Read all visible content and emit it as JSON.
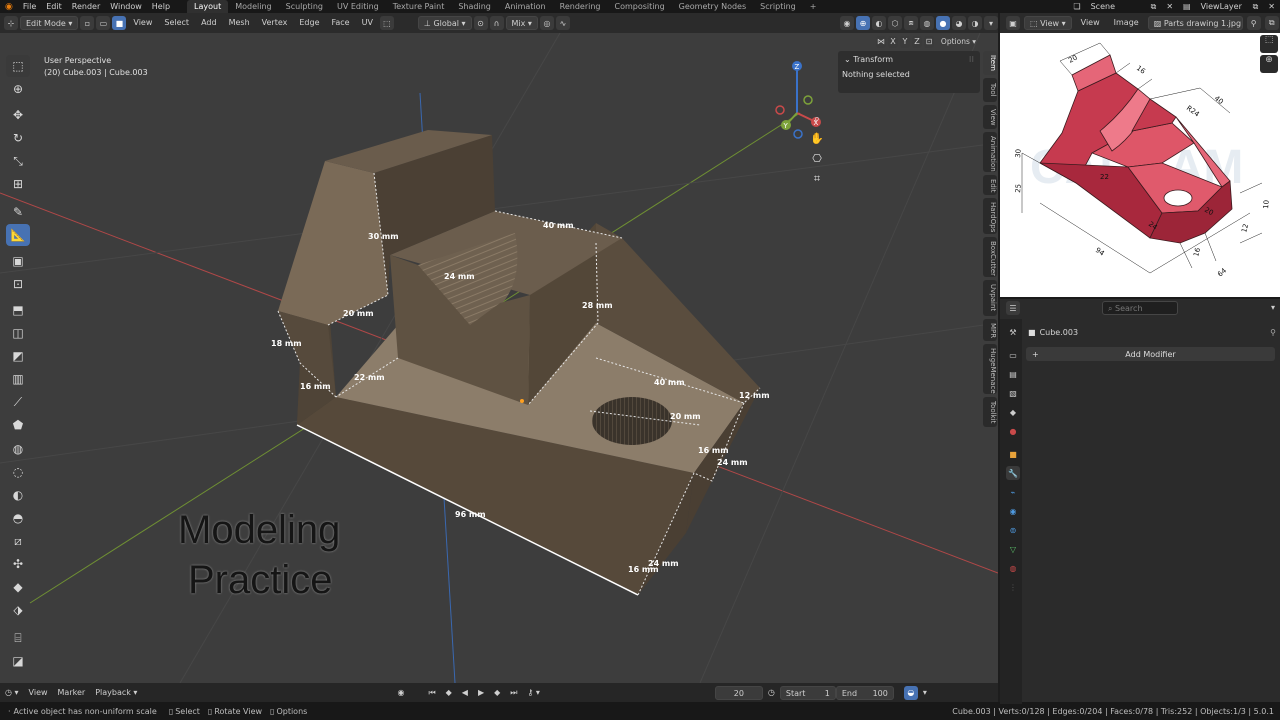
{
  "topbar": {
    "menus": [
      "File",
      "Edit",
      "Render",
      "Window",
      "Help"
    ],
    "workspaces": [
      "Layout",
      "Modeling",
      "Sculpting",
      "UV Editing",
      "Texture Paint",
      "Shading",
      "Animation",
      "Rendering",
      "Compositing",
      "Geometry Nodes",
      "Scripting"
    ],
    "add_tab": "+",
    "scene": "Scene",
    "view_layer": "ViewLayer"
  },
  "viewport_header": {
    "mode": "Edit Mode",
    "menus": [
      "View",
      "Select",
      "Add",
      "Mesh",
      "Vertex",
      "Edge",
      "Face",
      "UV"
    ],
    "orientation": "Global",
    "snap_mode": "Mix",
    "options": "Options",
    "xyz": [
      "X",
      "Y",
      "Z"
    ]
  },
  "viewport": {
    "perspective": "User Perspective",
    "object_info": "(20) Cube.003 | Cube.003",
    "overlay_title_1": "Modeling",
    "overlay_title_2": "Practice",
    "dims": [
      {
        "id": "d30",
        "text": "30 mm"
      },
      {
        "id": "d40a",
        "text": "40 mm"
      },
      {
        "id": "d24a",
        "text": "24 mm"
      },
      {
        "id": "d28",
        "text": "28 mm"
      },
      {
        "id": "d20a",
        "text": "20 mm"
      },
      {
        "id": "d18",
        "text": "18 mm"
      },
      {
        "id": "d16a",
        "text": "16 mm"
      },
      {
        "id": "d22",
        "text": "22 mm"
      },
      {
        "id": "d40b",
        "text": "40 mm"
      },
      {
        "id": "d12",
        "text": "12 mm"
      },
      {
        "id": "d20b",
        "text": "20 mm"
      },
      {
        "id": "d16b",
        "text": "16 mm"
      },
      {
        "id": "d24b",
        "text": "24 mm"
      },
      {
        "id": "d96",
        "text": "96 mm"
      },
      {
        "id": "d24c",
        "text": "24 mm"
      },
      {
        "id": "d16c",
        "text": "16 mm"
      }
    ]
  },
  "n_panel": {
    "section": "Transform",
    "content": "Nothing selected",
    "tabs": [
      "Item",
      "Tool",
      "View",
      "Animation",
      "Edit",
      "HardOps",
      "BoxCutter",
      "Uvpaint",
      "MPR",
      "HugeMenace",
      "Toolkit"
    ]
  },
  "timeline": {
    "menus": [
      "View",
      "Marker",
      "Playback"
    ],
    "current_frame": "20",
    "start_label": "Start",
    "start": "1",
    "end_label": "End",
    "end": "100"
  },
  "statusbar": {
    "message": "Active object has non-uniform scale",
    "hint_select": "Select",
    "hint_rotate": "Rotate View",
    "hint_options": "Options",
    "stats": "Cube.003 | Verts:0/128 | Edges:0/204 | Faces:0/78 | Tris:252 | Objects:1/3 | 5.0.1"
  },
  "image_editor": {
    "menus": [
      "View",
      "View",
      "Image"
    ],
    "image_name": "Parts drawing 1.jpg",
    "drawing_dims": [
      "20",
      "16",
      "40",
      "R24",
      "30",
      "22",
      "25",
      "24",
      "20",
      "94",
      "16",
      "64",
      "12",
      "10"
    ]
  },
  "properties": {
    "search_placeholder": "Search",
    "object_name": "Cube.003",
    "add_modifier": "Add Modifier"
  },
  "colors": {
    "viewport_bg": "#3d3d3d",
    "accent": "#4772b3",
    "mesh_face": "#7a6a55",
    "drawing_red": "#d9485a",
    "x_axis": "#c94a4a",
    "y_axis": "#7da23a",
    "z_axis": "#3a72c9"
  }
}
